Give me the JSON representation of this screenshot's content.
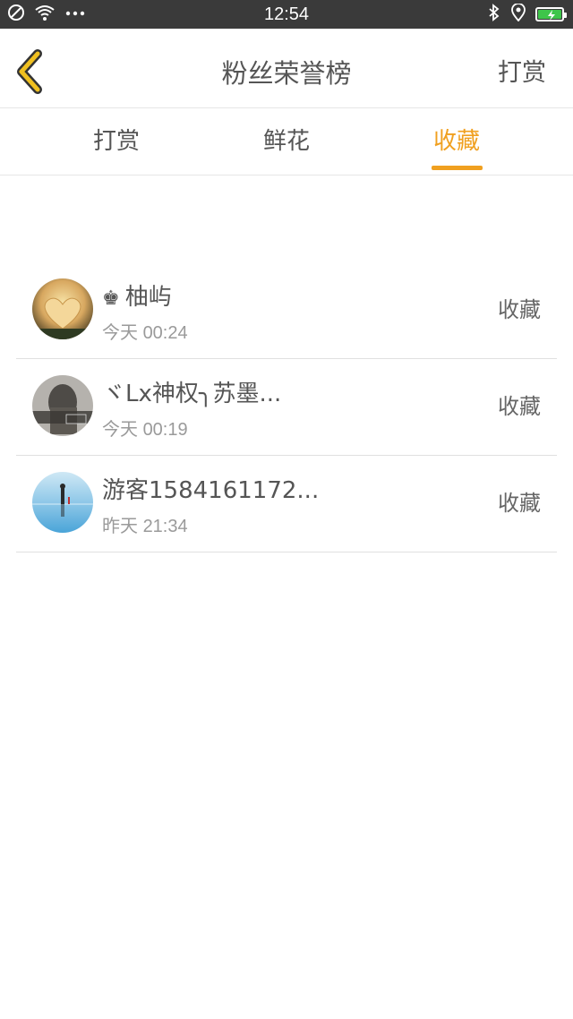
{
  "status_bar": {
    "time": "12:54",
    "left_icons": [
      "no-sim-icon",
      "wifi-icon",
      "more-dots-icon"
    ],
    "right_icons": [
      "bluetooth-icon",
      "location-icon",
      "battery-charging-icon"
    ],
    "battery_color": "#3ec54a"
  },
  "header": {
    "title": "粉丝荣誉榜",
    "action_label": "打赏",
    "back_icon_color": "#f0c020"
  },
  "tabs": {
    "items": [
      {
        "label": "打赏"
      },
      {
        "label": "鲜花"
      },
      {
        "label": "收藏"
      }
    ],
    "active_index": 2,
    "accent_color": "#f0a020"
  },
  "list": {
    "rows": [
      {
        "crown": "♚",
        "name": "柚屿",
        "day": "今天",
        "clock": "00:24",
        "action": "收藏"
      },
      {
        "crown": "",
        "name": "ヾLx神权╮苏墨...",
        "day": "今天",
        "clock": "00:19",
        "action": "收藏"
      },
      {
        "crown": "",
        "name": "游客1584161172...",
        "day": "昨天",
        "clock": "21:34",
        "action": "收藏"
      }
    ]
  }
}
